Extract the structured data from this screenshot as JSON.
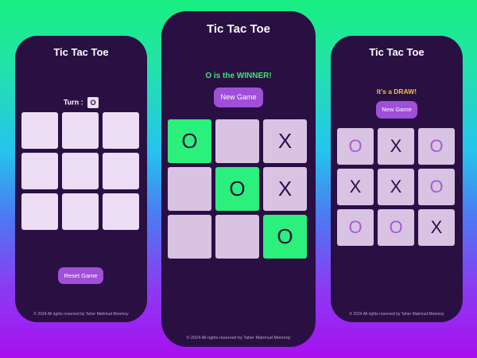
{
  "screens": [
    {
      "title": "Tic Tac Toe",
      "turn_label": "Turn :",
      "turn_value": "O",
      "button": "Reset Game",
      "footer": "© 2024 All rights reserved by Taher Mahmud Monmoy",
      "board": [
        "",
        "",
        "",
        "",
        "",
        "",
        "",
        "",
        ""
      ]
    },
    {
      "title": "Tic Tac Toe",
      "status": "O is the WINNER!",
      "button": "New Game",
      "footer": "© 2024 All rights reserved by Taher Mahmud Monmoy",
      "board": [
        "O",
        "",
        "X",
        "",
        "O",
        "X",
        "",
        "",
        "O"
      ],
      "winning_cells": [
        0,
        4,
        8
      ]
    },
    {
      "title": "Tic Tac Toe",
      "status": "It's a DRAW!",
      "button": "New Game",
      "footer": "© 2024 All rights reserved by Taher Mahmud Monmoy",
      "board": [
        "O",
        "X",
        "O",
        "X",
        "X",
        "O",
        "O",
        "O",
        "X"
      ]
    }
  ],
  "colors": {
    "panel": "#2a0f43",
    "win_cell": "#2bf07b",
    "winner_text": "#3fe56e",
    "draw_text": "#f2c24a",
    "button": "#a04fd8",
    "o_mark": "#a55cd6"
  }
}
